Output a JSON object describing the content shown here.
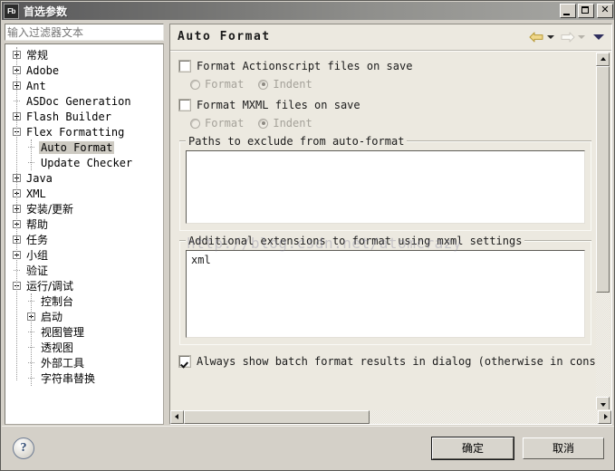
{
  "window": {
    "title": "首选参数",
    "app_icon_label": "Fb",
    "minimize_label": "_",
    "maximize_label": "",
    "close_label": "✕"
  },
  "sidebar": {
    "filter_placeholder": "输入过滤器文本",
    "filter_value": "",
    "items": [
      {
        "label": "常规",
        "indent": 0,
        "toggle": "plus",
        "selected": false,
        "cjk": true
      },
      {
        "label": "Adobe",
        "indent": 0,
        "toggle": "plus",
        "selected": false,
        "cjk": false
      },
      {
        "label": "Ant",
        "indent": 0,
        "toggle": "plus",
        "selected": false,
        "cjk": false
      },
      {
        "label": "ASDoc Generation",
        "indent": 0,
        "toggle": "leaf",
        "selected": false,
        "cjk": false
      },
      {
        "label": "Flash Builder",
        "indent": 0,
        "toggle": "plus",
        "selected": false,
        "cjk": false
      },
      {
        "label": "Flex Formatting",
        "indent": 0,
        "toggle": "minus",
        "selected": false,
        "cjk": false
      },
      {
        "label": "Auto Format",
        "indent": 1,
        "toggle": "leaf",
        "selected": true,
        "cjk": false
      },
      {
        "label": "Update Checker",
        "indent": 1,
        "toggle": "leaf",
        "selected": false,
        "cjk": false
      },
      {
        "label": "Java",
        "indent": 0,
        "toggle": "plus",
        "selected": false,
        "cjk": false
      },
      {
        "label": "XML",
        "indent": 0,
        "toggle": "plus",
        "selected": false,
        "cjk": false
      },
      {
        "label": "安装/更新",
        "indent": 0,
        "toggle": "plus",
        "selected": false,
        "cjk": true
      },
      {
        "label": "帮助",
        "indent": 0,
        "toggle": "plus",
        "selected": false,
        "cjk": true
      },
      {
        "label": "任务",
        "indent": 0,
        "toggle": "plus",
        "selected": false,
        "cjk": true
      },
      {
        "label": "小组",
        "indent": 0,
        "toggle": "plus",
        "selected": false,
        "cjk": true
      },
      {
        "label": "验证",
        "indent": 0,
        "toggle": "leaf",
        "selected": false,
        "cjk": true
      },
      {
        "label": "运行/调试",
        "indent": 0,
        "toggle": "minus",
        "selected": false,
        "cjk": true
      },
      {
        "label": "控制台",
        "indent": 1,
        "toggle": "leaf",
        "selected": false,
        "cjk": true
      },
      {
        "label": "启动",
        "indent": 1,
        "toggle": "plus",
        "selected": false,
        "cjk": true
      },
      {
        "label": "视图管理",
        "indent": 1,
        "toggle": "leaf",
        "selected": false,
        "cjk": true
      },
      {
        "label": "透视图",
        "indent": 1,
        "toggle": "leaf",
        "selected": false,
        "cjk": true
      },
      {
        "label": "外部工具",
        "indent": 1,
        "toggle": "leaf",
        "selected": false,
        "cjk": true
      },
      {
        "label": "字符串替换",
        "indent": 1,
        "toggle": "leaf",
        "selected": false,
        "cjk": true
      }
    ]
  },
  "page": {
    "title": "Auto Format",
    "nav": {
      "back_icon": "back-arrow-icon",
      "back_color": "#e8c96a",
      "forward_icon": "forward-arrow-icon",
      "forward_color": "#f2f0ea",
      "menu_icon": "chevron-down-icon",
      "menu_color": "#2f2f5e"
    },
    "actionscript": {
      "checkbox_label": "Format Actionscript files on save",
      "checked": false,
      "radio_format_label": "Format",
      "radio_indent_label": "Indent",
      "selected_radio": "Indent",
      "radios_disabled": true
    },
    "mxml": {
      "checkbox_label": "Format MXML files on save",
      "checked": false,
      "radio_format_label": "Format",
      "radio_indent_label": "Indent",
      "selected_radio": "Indent",
      "radios_disabled": true
    },
    "exclude_group": {
      "title": "Paths to exclude from auto-format",
      "value": ""
    },
    "extensions_group": {
      "title": "Additional extensions to format using mxml settings",
      "value": "xml"
    },
    "batch_results": {
      "checkbox_label": "Always show batch format results in dialog (otherwise in console)",
      "checked": true
    }
  },
  "footer": {
    "help_label": "?",
    "ok_label": "确定",
    "cancel_label": "取消"
  },
  "watermark": {
    "text": "http://blog.csdn.net/atomcrazy"
  }
}
